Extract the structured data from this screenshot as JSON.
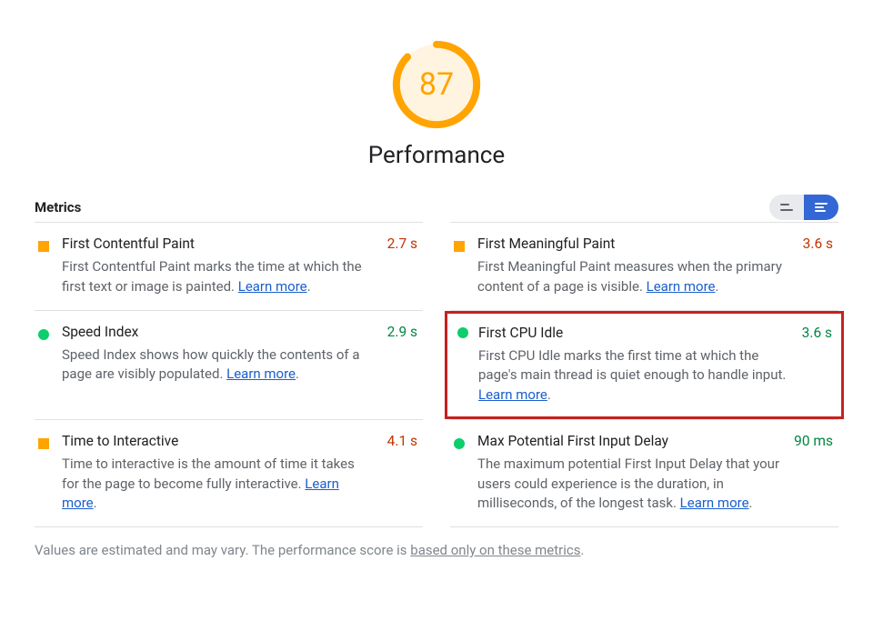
{
  "gauge": {
    "score": "87",
    "percent": 87,
    "stroke_color": "#FFA400",
    "fill_color": "#FFF4E0"
  },
  "category_title": "Performance",
  "metrics_heading": "Metrics",
  "learn_more_label": "Learn more",
  "metrics": [
    {
      "title": "First Contentful Paint",
      "value": "2.7 s",
      "status": "orange",
      "desc_before": "First Contentful Paint marks the time at which the first text or image is painted. ",
      "desc_after": "."
    },
    {
      "title": "First Meaningful Paint",
      "value": "3.6 s",
      "status": "orange",
      "desc_before": "First Meaningful Paint measures when the primary content of a page is visible. ",
      "desc_after": "."
    },
    {
      "title": "Speed Index",
      "value": "2.9 s",
      "status": "green",
      "desc_before": "Speed Index shows how quickly the contents of a page are visibly populated. ",
      "desc_after": "."
    },
    {
      "title": "First CPU Idle",
      "value": "3.6 s",
      "status": "green",
      "highlighted": true,
      "desc_before": "First CPU Idle marks the first time at which the page's main thread is quiet enough to handle input. ",
      "desc_after": "."
    },
    {
      "title": "Time to Interactive",
      "value": "4.1 s",
      "status": "orange",
      "desc_before": "Time to interactive is the amount of time it takes for the page to become fully interactive. ",
      "desc_after": "."
    },
    {
      "title": "Max Potential First Input Delay",
      "value": "90 ms",
      "status": "green",
      "desc_before": "The maximum potential First Input Delay that your users could experience is the duration, in milliseconds, of the longest task. ",
      "desc_after": "."
    }
  ],
  "footer": {
    "before": "Values are estimated and may vary. The performance score is ",
    "link": "based only on these metrics",
    "after": "."
  }
}
